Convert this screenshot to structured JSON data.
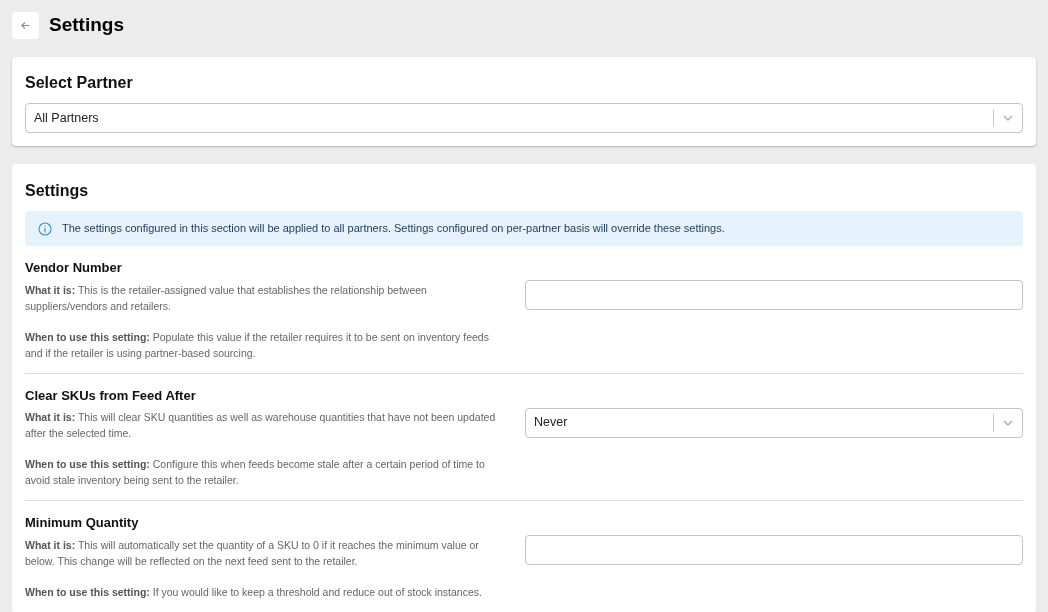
{
  "page_title": "Settings",
  "partner_card": {
    "title": "Select Partner",
    "select": {
      "value": "All Partners"
    }
  },
  "settings_card": {
    "title": "Settings",
    "info": "The settings configured in this section will be applied to all partners. Settings configured on per-partner basis will override these settings.",
    "settings": [
      {
        "kind": "input",
        "title": "Vendor Number",
        "what": "**What it is:** This is the retailer-assigned value that establishes the relationship between suppliers/vendors and retailers.",
        "when": "**When to use this setting:** Populate this value if the retailer requires it to be sent on inventory feeds and if the retailer is using partner-based sourcing."
      },
      {
        "kind": "select",
        "title": "Clear SKUs from Feed After",
        "what": "**What it is:** This will clear SKU quantities as well as warehouse quantities that have not been updated after the selected time.",
        "when": "**When to use this setting:** Configure this when feeds become stale after a certain period of time to avoid stale inventory being sent to the retailer.",
        "value": "Never"
      },
      {
        "kind": "input",
        "title": "Minimum Quantity",
        "what": "**What it is:** This will automatically set the quantity of a SKU to 0 if it reaches the minimum value or below. This change will be reflected on the next feed sent to the retailer.",
        "when": "**When to use this setting:** If you would like to keep a threshold and reduce out of stock instances."
      }
    ]
  }
}
